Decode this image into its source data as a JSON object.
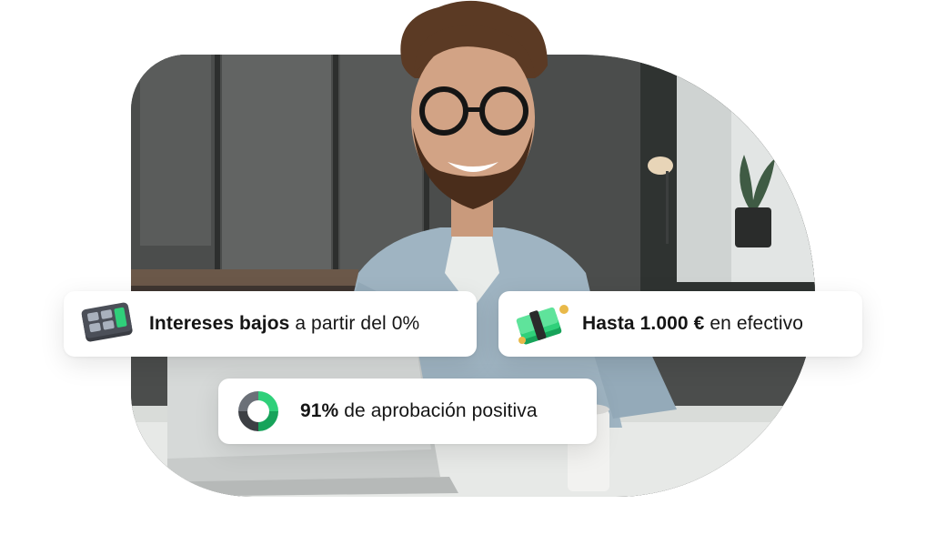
{
  "hero": {
    "photo_subject": "smiling bearded man with glasses at a laptop"
  },
  "features": [
    {
      "icon": "calculator-icon",
      "bold": "Intereses bajos",
      "text": " a partir del 0%"
    },
    {
      "icon": "cash-stack-icon",
      "bold": "Hasta 1.000 €",
      "text": " en efectivo"
    },
    {
      "icon": "approval-ring-icon",
      "bold": "91%",
      "text": " de aprobación positiva"
    }
  ],
  "colors": {
    "accent_green": "#2fd07a",
    "dark_green": "#17a35a",
    "text": "#151515"
  }
}
